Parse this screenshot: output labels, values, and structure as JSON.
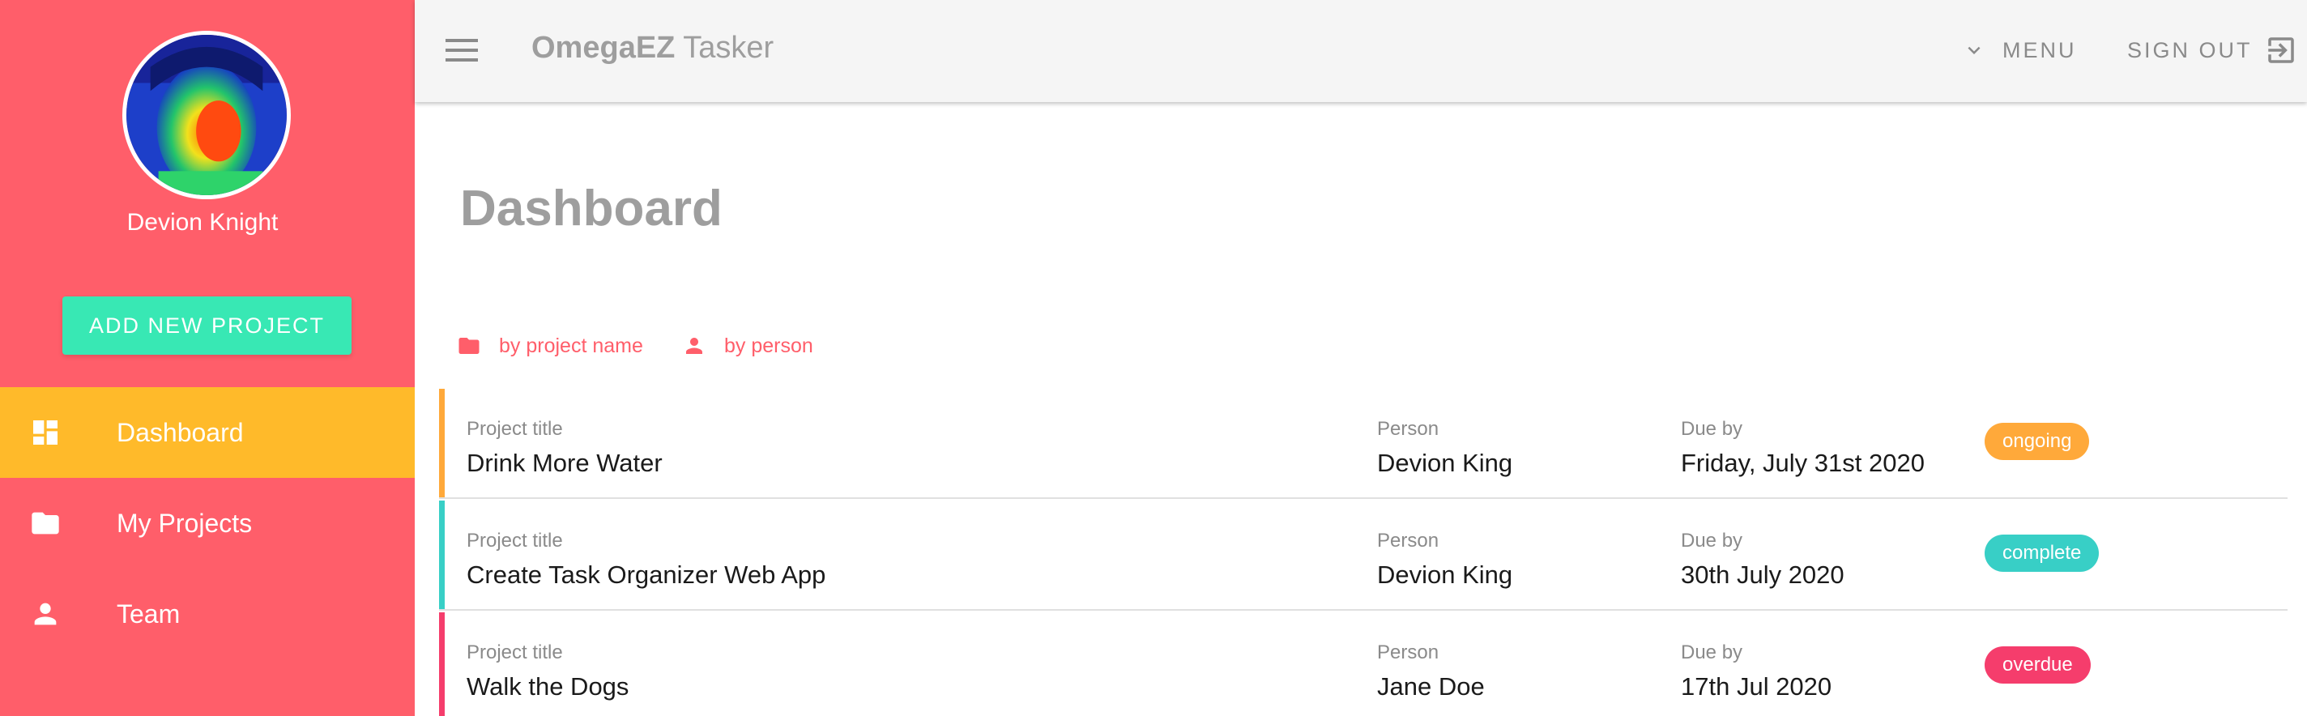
{
  "app": {
    "title_strong": "OmegaEZ",
    "title_light": " Tasker"
  },
  "topbar": {
    "menu_label": "MENU",
    "signout_label": "SIGN OUT"
  },
  "profile": {
    "name": "Devion Knight"
  },
  "sidebar": {
    "add_button_label": "ADD NEW PROJECT",
    "items": [
      {
        "label": "Dashboard",
        "icon": "dashboard-icon",
        "active": true
      },
      {
        "label": "My Projects",
        "icon": "folder-icon",
        "active": false
      },
      {
        "label": "Team",
        "icon": "person-icon",
        "active": false
      }
    ]
  },
  "main": {
    "page_title": "Dashboard",
    "sort": {
      "by_project": "by project name",
      "by_person": "by person"
    },
    "columns": {
      "title": "Project title",
      "person": "Person",
      "due": "Due by"
    },
    "projects": [
      {
        "title": "Drink More Water",
        "person": "Devion King",
        "due": "Friday, July 31st 2020",
        "status": "ongoing",
        "color": "#FFA93A"
      },
      {
        "title": "Create Task Organizer Web App",
        "person": "Devion King",
        "due": "30th July 2020",
        "status": "complete",
        "color": "#38CFC6"
      },
      {
        "title": "Walk the Dogs",
        "person": "Jane Doe",
        "due": "17th Jul 2020",
        "status": "overdue",
        "color": "#F53D6C"
      }
    ]
  },
  "colors": {
    "sidebar": "#FF5E6A",
    "active_nav": "#FFBA2A",
    "add_button": "#38E8B4",
    "topbar": "#F5F5F5"
  }
}
